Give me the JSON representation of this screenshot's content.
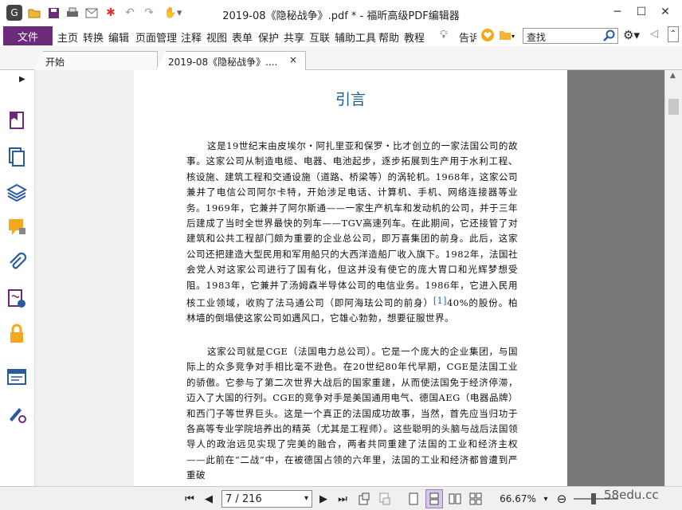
{
  "window": {
    "title": "2019-08《隐秘战争》.pdf * - 福昕高级PDF编辑器"
  },
  "menu": {
    "file": "文件",
    "items": [
      "主页",
      "转换",
      "编辑",
      "页面管理",
      "注释",
      "视图",
      "表单",
      "保护",
      "共享",
      "互联",
      "辅助工具",
      "帮助",
      "教程"
    ],
    "tell": "告诉",
    "search_placeholder": "查找"
  },
  "tabs": [
    {
      "label": "开始"
    },
    {
      "label": "2019-08《隐秘战争》....",
      "close": "×"
    }
  ],
  "document": {
    "heading": "引言",
    "para1_a": "这是19世纪末由皮埃尔・阿扎里亚和保罗・比才创立的一家法国公司的故事。这家公司从制造电缆、电器、电池起步，逐步拓展到生产用于水利工程、核设施、建筑工程和交通设施（道路、桥梁等）的涡轮机。1968年，这家公司兼并了电信公司阿尔卡特，开始涉足电话、计算机、手机、网络连接器等业务。1969年，它兼并了阿尔斯通——一家生产机车和发动机的公司，并于三年后建成了当时全世界最快的列车——TGV高速列车。在此期间，它还接管了对建筑和公共工程部门颇为重要的企业总公司，即万喜集团的前身。此后，这家公司还把建造大型民用和军用船只的大西洋造船厂收入旗下。1982年，法国社会党人对这家公司进行了国有化，但这并没有使它的庞大胃口和光辉梦想受阻。1983年，它兼并了汤姆森半导体公司的电信业务。1986年，它进入民用核工业领域，收购了法马通公司（即阿海珐公司的前身）",
    "ref": "[1]",
    "para1_b": "40%的股份。柏林墙的倒塌使这家公司如遇风口，它雄心勃勃，想要征服世界。",
    "para2": "这家公司就是CGE（法国电力总公司）。它是一个庞大的企业集团，与国际上的众多竞争对手相比毫不逊色。在20世纪80年代早期，CGE是法国工业的骄傲。它参与了第二次世界大战后的国家重建，从而使法国免于经济停滞，迈入了大国的行列。CGE的竞争对手是美国通用电气、德国AEG（电器品牌）和西门子等世界巨头。这是一个真正的法国成功故事，当然，首先应当归功于各高等专业学院培养出的精英（尤其是工程师）。这些聪明的头脑与战后法国领导人的政治远见实现了完美的融合，两者共同重建了法国的工业和经济主权——此前在“二战”中，在被德国占领的六年里，法国的工业和经济都曾遭到严重破"
  },
  "status": {
    "page": "7 / 216",
    "zoom": "66.67%",
    "watermark": "58edu.cc"
  },
  "colors": {
    "file_menu_bg": "#6c2a7a",
    "heading": "#1f5a8c",
    "link": "#1f5fc8",
    "gray_area": "#7a7a7a"
  },
  "icons": [
    "app-logo-icon",
    "open-folder-icon",
    "save-icon",
    "print-icon",
    "mail-icon",
    "new-icon",
    "undo-icon",
    "redo-icon",
    "hand-tool-icon",
    "minimize-icon",
    "maximize-icon",
    "close-icon",
    "bulb-icon",
    "heart-icon",
    "folder-search-icon",
    "search-icon",
    "gear-icon",
    "chevron-left-icon",
    "collapse-icon",
    "bookmark-icon",
    "pages-icon",
    "layers-icon",
    "comments-icon",
    "attachment-icon",
    "signature-icon",
    "lock-icon",
    "form-fields-icon",
    "stamp-icon",
    "first-page-icon",
    "prev-page-icon",
    "next-page-icon",
    "last-page-icon",
    "single-page-icon",
    "continuous-icon",
    "facing-icon",
    "zoom-out-icon",
    "zoom-in-icon"
  ]
}
